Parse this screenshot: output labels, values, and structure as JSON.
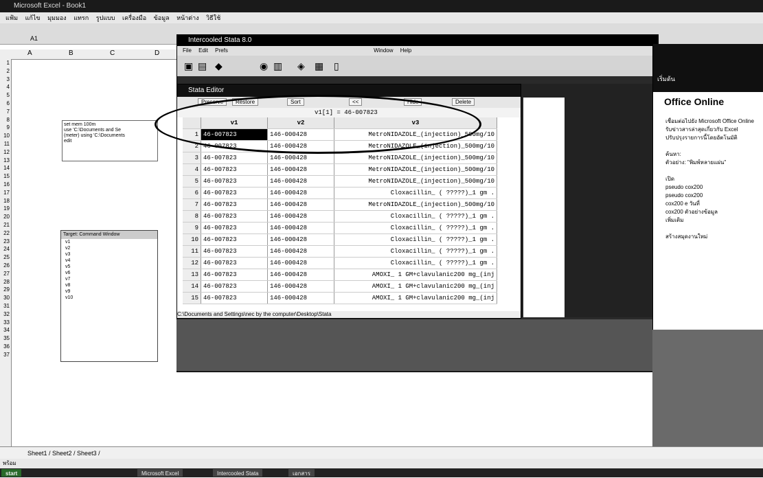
{
  "excel": {
    "title": "Microsoft Excel - Book1",
    "menu": [
      "แฟ้ม",
      "แก้ไข",
      "มุมมอง",
      "แทรก",
      "รูปแบบ",
      "เครื่องมือ",
      "ข้อมูล",
      "หน้าต่าง",
      "วิธีใช้"
    ],
    "name_box": "A1",
    "columns": [
      "A",
      "B",
      "C",
      "D"
    ],
    "rows": [
      "1",
      "2",
      "3",
      "4",
      "5",
      "6",
      "7",
      "8",
      "9",
      "10",
      "11",
      "12",
      "13",
      "14",
      "15",
      "16",
      "17",
      "18",
      "19",
      "20",
      "21",
      "22",
      "23",
      "24",
      "25",
      "26",
      "27",
      "28",
      "29",
      "30",
      "31",
      "32",
      "33",
      "34",
      "35",
      "36",
      "37"
    ],
    "sheet_tabs": "Sheet1 / Sheet2 / Sheet3 /",
    "status": "พร้อม"
  },
  "cmdlog": [
    "set mem 100m",
    "use 'C:\\Documents and Se",
    "(meter) using 'C:\\Documents",
    "edit"
  ],
  "varpanel": {
    "title": "Target: Command Window",
    "items": [
      "v1",
      "v2",
      "v3",
      "v4",
      "v5",
      "v6",
      "v7",
      "v8",
      "v9",
      "v10"
    ]
  },
  "stata": {
    "title": "Intercooled Stata 8.0",
    "menu": [
      "File",
      "Edit",
      "Prefs",
      "Window",
      "Help"
    ]
  },
  "editor": {
    "title": "Stata Editor",
    "buttons": [
      "Preserve",
      "Restore",
      "Sort",
      "<<",
      "Hide",
      "Delete"
    ],
    "cell_ref": "v1[1] = 46-007823",
    "columns": [
      "v1",
      "v2",
      "v3"
    ],
    "rows": [
      {
        "n": "1",
        "v1": "46-007823",
        "v2": "146-000428",
        "v3": "MetroNIDAZOLE_(injection)_500mg/10"
      },
      {
        "n": "2",
        "v1": "46-007823",
        "v2": "146-000428",
        "v3": "MetroNIDAZOLE_(injection)_500mg/10"
      },
      {
        "n": "3",
        "v1": "46-007823",
        "v2": "146-000428",
        "v3": "MetroNIDAZOLE_(injection)_500mg/10"
      },
      {
        "n": "4",
        "v1": "46-007823",
        "v2": "146-000428",
        "v3": "MetroNIDAZOLE_(injection)_500mg/10"
      },
      {
        "n": "5",
        "v1": "46-007823",
        "v2": "146-000428",
        "v3": "MetroNIDAZOLE_(injection)_500mg/10"
      },
      {
        "n": "6",
        "v1": "46-007823",
        "v2": "146-000428",
        "v3": "Cloxacillin_ ( ?????)_1 gm ."
      },
      {
        "n": "7",
        "v1": "46-007823",
        "v2": "146-000428",
        "v3": "MetroNIDAZOLE_(injection)_500mg/10"
      },
      {
        "n": "8",
        "v1": "46-007823",
        "v2": "146-000428",
        "v3": "Cloxacillin_ ( ?????)_1 gm ."
      },
      {
        "n": "9",
        "v1": "46-007823",
        "v2": "146-000428",
        "v3": "Cloxacillin_ ( ?????)_1 gm ."
      },
      {
        "n": "10",
        "v1": "46-007823",
        "v2": "146-000428",
        "v3": "Cloxacillin_ ( ?????)_1 gm ."
      },
      {
        "n": "11",
        "v1": "46-007823",
        "v2": "146-000428",
        "v3": "Cloxacillin_ ( ?????)_1 gm ."
      },
      {
        "n": "12",
        "v1": "46-007823",
        "v2": "146-000428",
        "v3": "Cloxacillin_ ( ?????)_1 gm ."
      },
      {
        "n": "13",
        "v1": "46-007823",
        "v2": "146-000428",
        "v3": "AMOXI_ 1 GM+clavulanic200 mg_(inj"
      },
      {
        "n": "14",
        "v1": "46-007823",
        "v2": "146-000428",
        "v3": "AMOXI_ 1 GM+clavulanic200 mg_(inj"
      },
      {
        "n": "15",
        "v1": "46-007823",
        "v2": "146-000428",
        "v3": "AMOXI_ 1 GM+clavulanic200 mg_(inj"
      }
    ],
    "path": "C:\\Documents and Settings\\nec by the computer\\Desktop\\Stata"
  },
  "right_panel": {
    "title": "เริ่มต้น",
    "online": "Office Online",
    "links": [
      "เชื่อมต่อไปยัง Microsoft Office Online",
      "รับข่าวสารล่าสุดเกี่ยวกับ Excel",
      "ปรับปรุงรายการนี้โดยอัตโนมัติ",
      "ค้นหา:",
      "ตัวอย่าง: \"พิมพ์หลายแผ่น\"",
      "เปิด",
      "pseudo cox200",
      "pseudo cox200",
      "cox200 e วันที่",
      "cox200 ตัวอย่างข้อมูล",
      "เพิ่มเติม",
      "สร้างสมุดงานใหม่"
    ]
  },
  "taskbar": {
    "start": "start",
    "items": [
      "Microsoft Excel",
      "Intercooled Stata",
      "เอกสาร"
    ]
  }
}
